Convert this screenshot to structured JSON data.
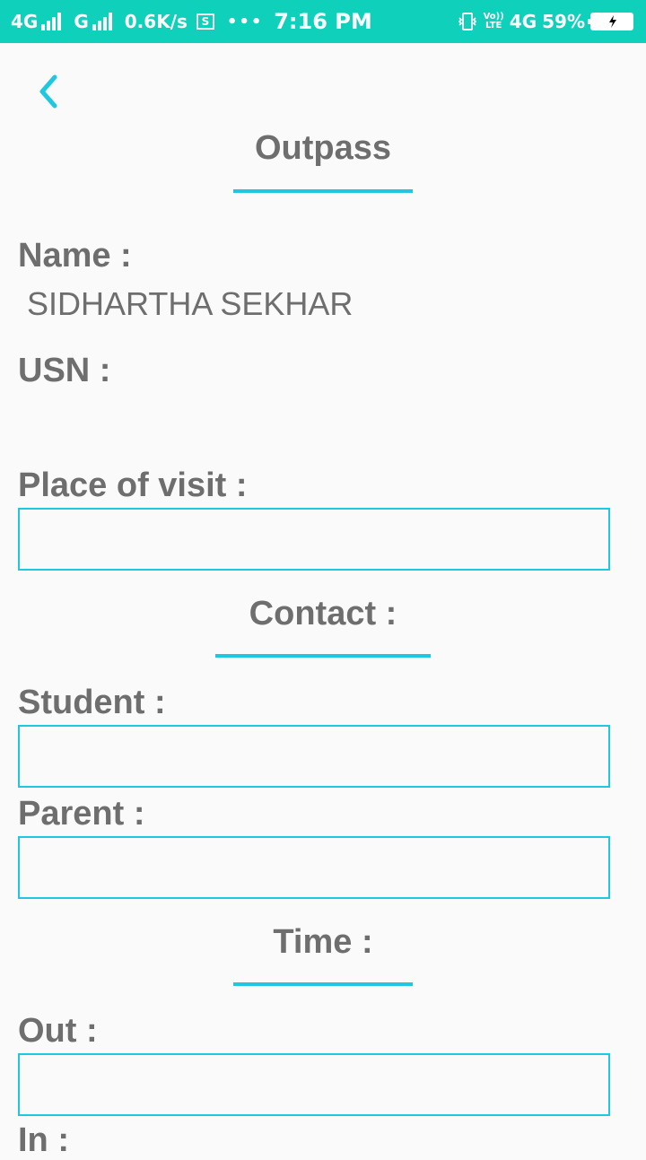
{
  "status_bar": {
    "net1": "4G",
    "net2": "G",
    "speed": "0.6K/s",
    "screenshot_glyph": "S",
    "more": "•••",
    "time": "7:16 PM",
    "volte_top": "Vo))",
    "volte_bottom": "LTE",
    "net3": "4G",
    "battery": "59%"
  },
  "header": {
    "back_icon": "chevron-left-icon",
    "title": "Outpass"
  },
  "form": {
    "name_label": "Name :",
    "name_value": "SIDHARTHA SEKHAR",
    "usn_label": "USN :",
    "usn_value": "",
    "place_label": "Place of visit :",
    "place_value": "",
    "contact_title": "Contact :",
    "student_label": "Student :",
    "student_value": "",
    "parent_label": "Parent :",
    "parent_value": "",
    "time_title": "Time :",
    "out_label": "Out :",
    "out_value": "",
    "in_label": "In :"
  },
  "colors": {
    "status_bar": "#0fd1bb",
    "accent": "#1ec8e1",
    "text": "#6e6e6e",
    "background": "#fafafa"
  }
}
